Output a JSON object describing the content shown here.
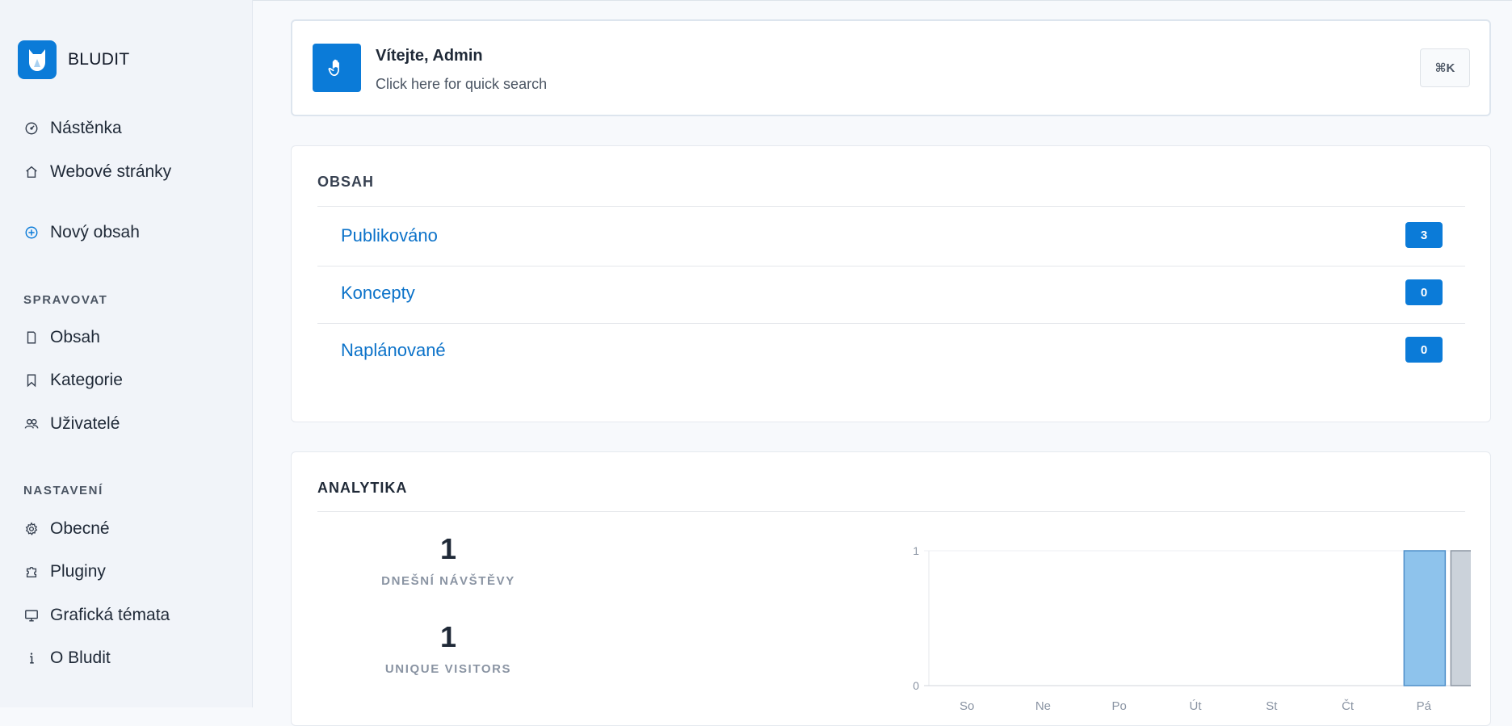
{
  "brand": {
    "name": "BLUDIT",
    "accent": "#0b7bd8"
  },
  "sidebar": {
    "items_top": [
      {
        "label": "Nástěnka",
        "icon": "dashboard-gauge-icon"
      },
      {
        "label": "Webové stránky",
        "icon": "home-icon"
      },
      {
        "label": "Nový obsah",
        "icon": "plus-circle-icon"
      }
    ],
    "manage_label": "SPRAVOVAT",
    "manage_items": [
      {
        "label": "Obsah",
        "icon": "document-icon"
      },
      {
        "label": "Kategorie",
        "icon": "bookmark-icon"
      },
      {
        "label": "Uživatelé",
        "icon": "users-icon"
      }
    ],
    "settings_label": "NASTAVENÍ",
    "settings_items": [
      {
        "label": "Obecné",
        "icon": "gear-icon"
      },
      {
        "label": "Pluginy",
        "icon": "puzzle-icon"
      },
      {
        "label": "Grafická témata",
        "icon": "monitor-icon"
      },
      {
        "label": "O Bludit",
        "icon": "info-icon"
      }
    ]
  },
  "welcome": {
    "title": "Vítejte, Admin",
    "subtitle": "Click here for quick search",
    "shortcut": "⌘K",
    "icon": "waving-hand-icon"
  },
  "content": {
    "heading": "OBSAH",
    "rows": [
      {
        "label": "Publikováno",
        "count": "3"
      },
      {
        "label": "Koncepty",
        "count": "0"
      },
      {
        "label": "Naplánované",
        "count": "0"
      }
    ]
  },
  "analytics": {
    "heading": "ANALYTIKA",
    "today_visits": {
      "value": "1",
      "label": "DNEŠNÍ NÁVŠTĚVY"
    },
    "unique_visitors": {
      "value": "1",
      "label": "UNIQUE VISITORS"
    }
  },
  "chart_data": {
    "type": "bar",
    "categories": [
      "So",
      "Ne",
      "Po",
      "Út",
      "St",
      "Čt",
      "Pá"
    ],
    "series": [
      {
        "values": [
          0,
          0,
          0,
          0,
          0,
          0,
          1
        ],
        "color": "#8ec3ec"
      },
      {
        "values": [
          0,
          0,
          0,
          0,
          0,
          0,
          1
        ],
        "color": "#cbd2da"
      }
    ],
    "y_ticks": [
      "0",
      "1"
    ],
    "ylim": [
      0,
      1
    ],
    "grid": true
  }
}
